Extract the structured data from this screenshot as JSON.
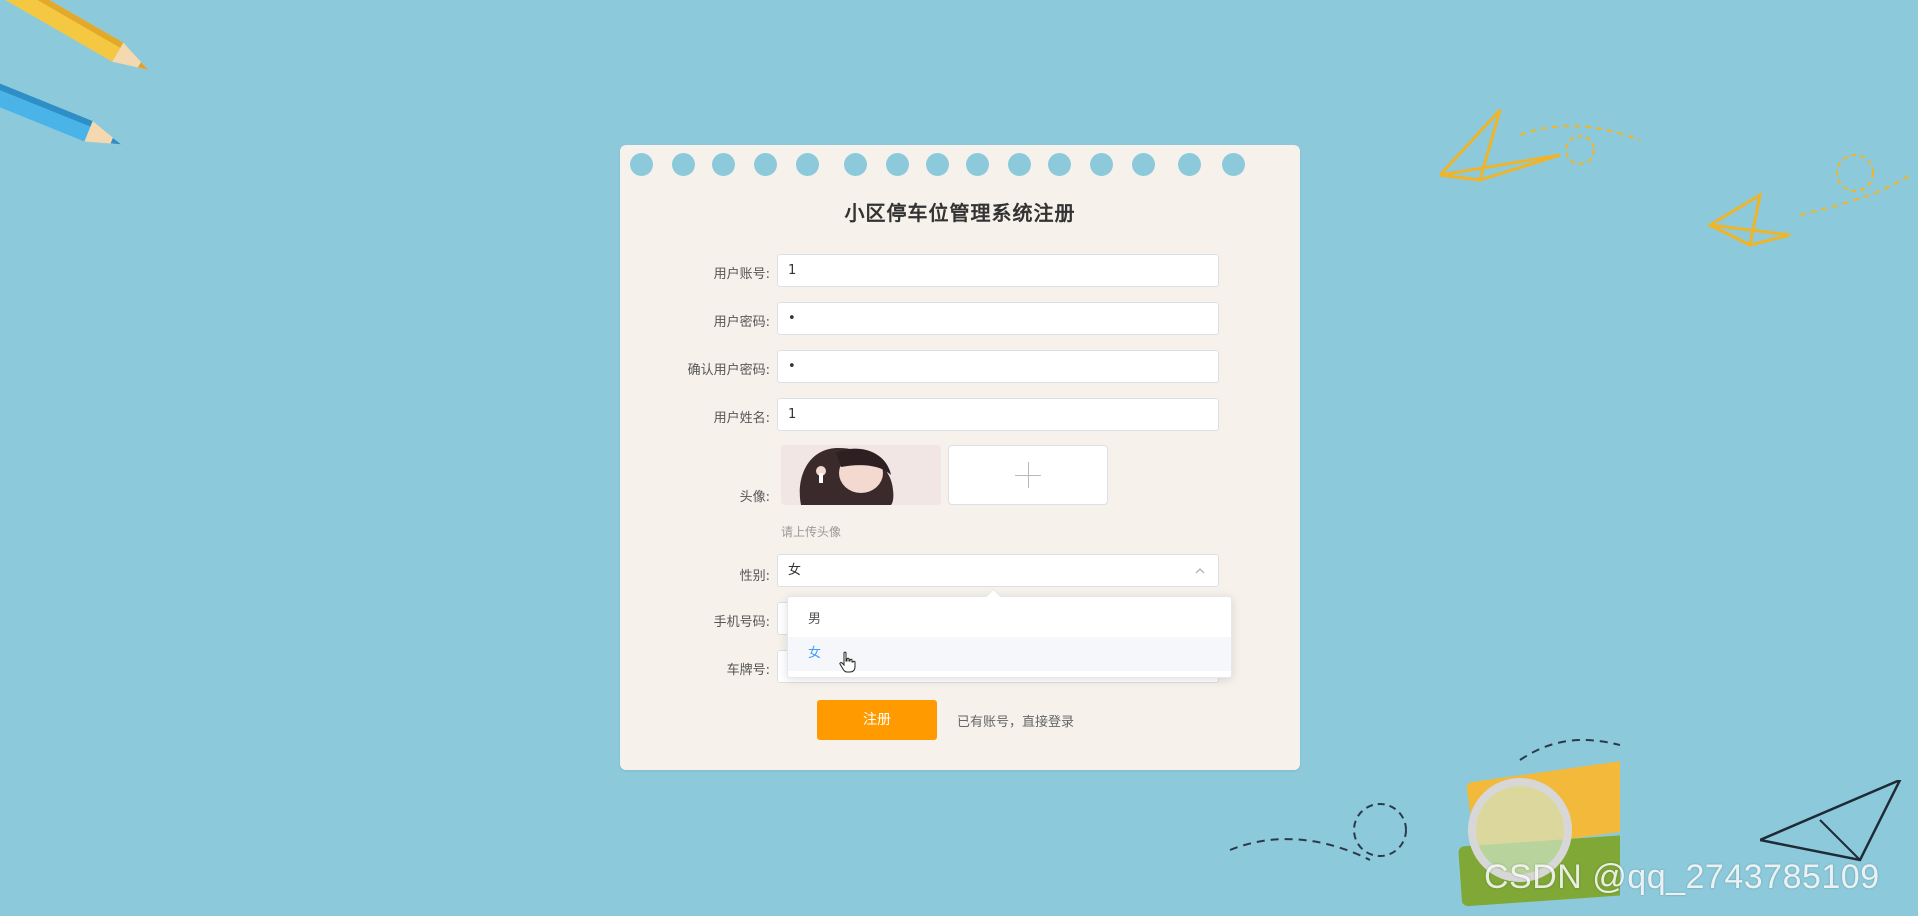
{
  "form": {
    "title": "小区停车位管理系统注册",
    "fields": {
      "account": {
        "label": "用户账号:",
        "value": "1"
      },
      "password": {
        "label": "用户密码:",
        "value": "•"
      },
      "confirm_password": {
        "label": "确认用户密码:",
        "value": "•"
      },
      "name": {
        "label": "用户姓名:",
        "value": "1"
      },
      "avatar": {
        "label": "头像:",
        "hint": "请上传头像"
      },
      "gender": {
        "label": "性别:",
        "value": "女",
        "options": [
          "男",
          "女"
        ],
        "highlighted": "女"
      },
      "phone": {
        "label": "手机号码:",
        "value": ""
      },
      "plate": {
        "label": "车牌号:",
        "value": ""
      }
    },
    "submit_label": "注册",
    "login_link": "已有账号，直接登录"
  },
  "watermark": "CSDN @qq_2743785109",
  "colors": {
    "background": "#8ccadb",
    "card": "#f6f1eb",
    "button": "#ff9a00",
    "option_active": "#409eff"
  },
  "icons": [
    "plus-icon",
    "chevron-up-icon",
    "hand-cursor-icon"
  ]
}
